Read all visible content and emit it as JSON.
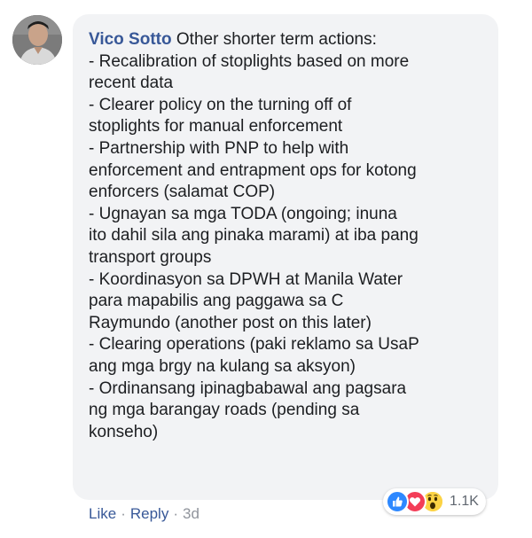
{
  "comment": {
    "author": "Vico Sotto",
    "intro": "Other shorter term actions:",
    "lines": [
      "- Recalibration of stoplights based on more",
      "recent data",
      "- Clearer policy on the turning off of",
      "stoplights for manual enforcement",
      "- Partnership with PNP to help with",
      "enforcement and entrapment ops for kotong",
      "enforcers (salamat COP)",
      "- Ugnayan sa mga TODA (ongoing; inuna",
      "ito dahil sila ang pinaka marami) at iba pang",
      "transport groups",
      "- Koordinasyon sa DPWH at Manila Water",
      "para mapabilis ang paggawa sa C",
      "Raymundo (another post on this later)",
      "- Clearing operations (paki reklamo sa UsaP",
      "ang mga brgy na kulang sa aksyon)",
      "- Ordinansang ipinagbabawal ang pagsara",
      "ng mga barangay roads (pending sa",
      "konseho)"
    ]
  },
  "actions": {
    "like_label": "Like",
    "separator": "·",
    "reply_label": "Reply",
    "timestamp": "3d"
  },
  "reactions": {
    "icons": [
      "like-icon",
      "love-icon",
      "wow-icon"
    ],
    "count": "1.1K"
  },
  "colors": {
    "author": "#385898",
    "bubble": "#f2f3f5",
    "text": "#1c1e21",
    "meta": "#90949c",
    "like": "#2d88ff",
    "love": "#f33e58",
    "wow": "#fcd345"
  }
}
